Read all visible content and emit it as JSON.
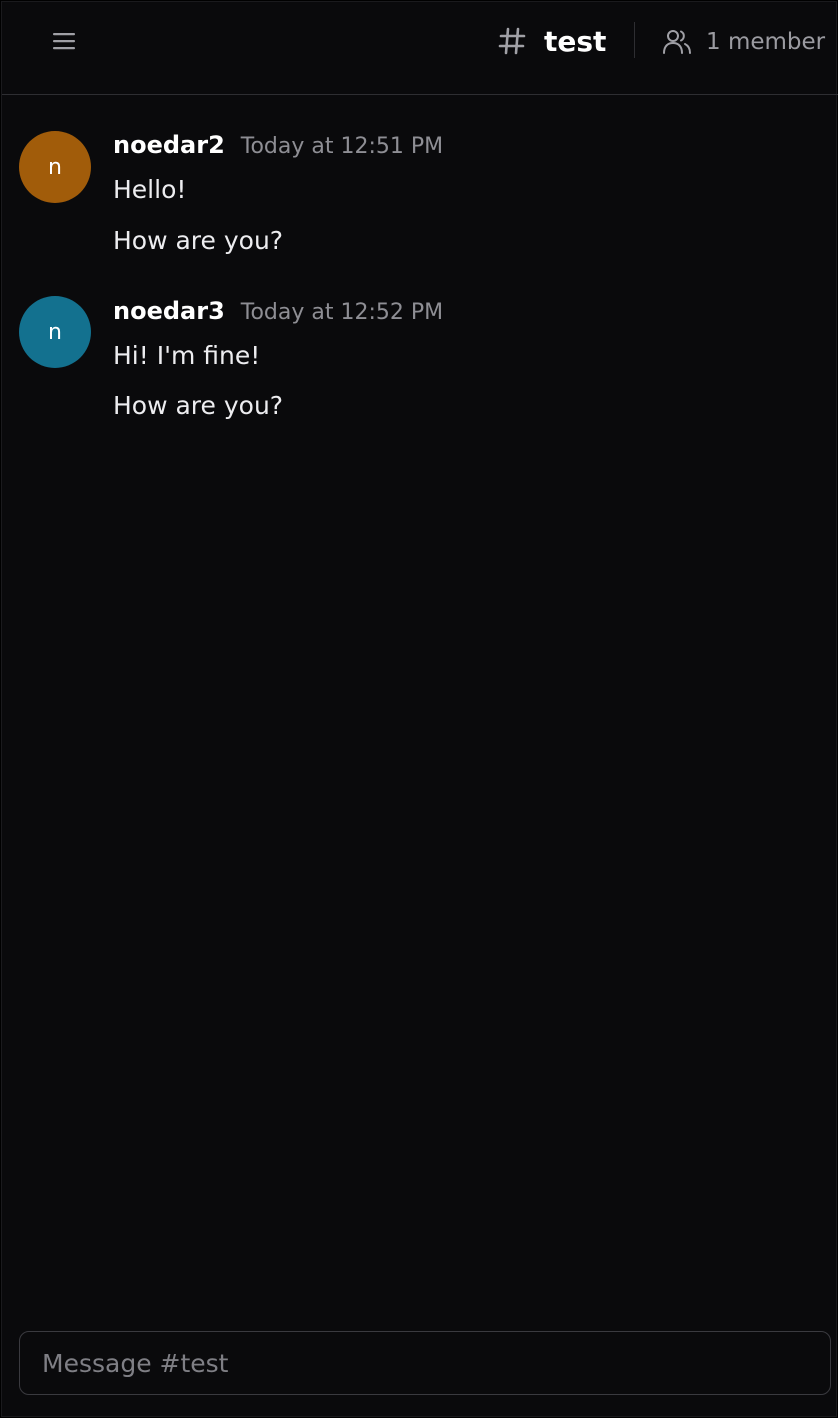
{
  "header": {
    "channel_name": "test",
    "member_count_label": "1 member"
  },
  "messages": [
    {
      "username": "noedar2",
      "timestamp": "Today at 12:51 PM",
      "avatar_letter": "n",
      "avatar_color": "#a15c0a",
      "lines": [
        "Hello!",
        "How are you?"
      ]
    },
    {
      "username": "noedar3",
      "timestamp": "Today at 12:52 PM",
      "avatar_letter": "n",
      "avatar_color": "#13718f",
      "lines": [
        "Hi! I'm fine!",
        "How are you?"
      ]
    }
  ],
  "composer": {
    "placeholder": "Message #test",
    "value": ""
  },
  "icons": {
    "menu": "hamburger-menu-icon",
    "channel": "hash-icon",
    "members": "users-icon"
  },
  "colors": {
    "background": "#0a0a0c",
    "divider": "#2e2e32",
    "text": "#ededf0",
    "muted": "#8e8e94"
  }
}
